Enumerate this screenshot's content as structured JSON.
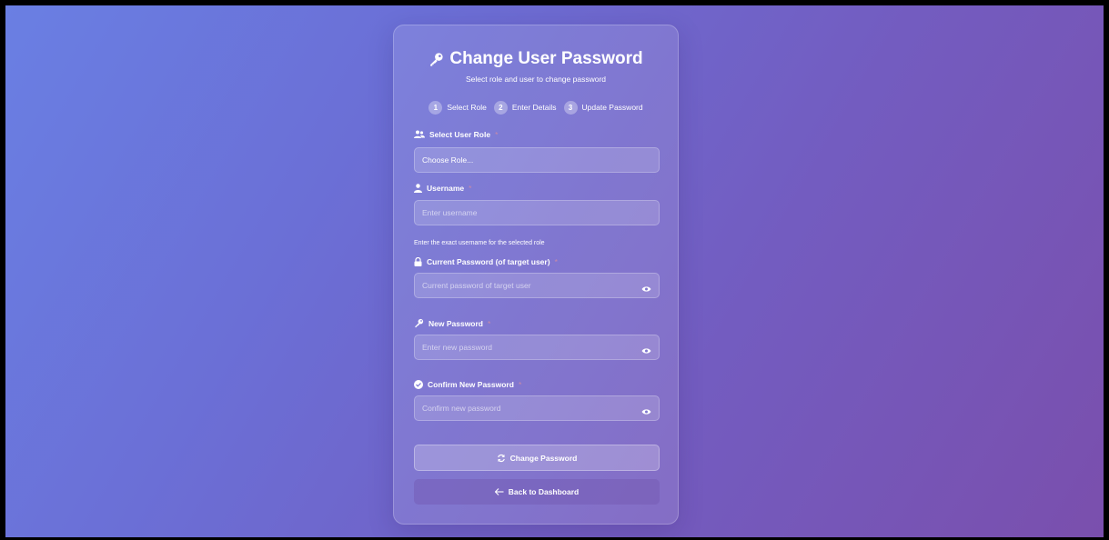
{
  "card": {
    "title": "Change User Password",
    "subtitle": "Select role and user to change password",
    "title_icon": "key-icon"
  },
  "steps": [
    {
      "num": "1",
      "label": "Select Role"
    },
    {
      "num": "2",
      "label": "Enter Details"
    },
    {
      "num": "3",
      "label": "Update Password"
    }
  ],
  "form": {
    "role": {
      "label": "Select User Role",
      "required": "*",
      "value": "Choose Role...",
      "icon": "users-icon"
    },
    "username": {
      "label": "Username",
      "required": "*",
      "placeholder": "Enter username",
      "hint": "Enter the exact username for the selected role",
      "icon": "user-icon"
    },
    "current_password": {
      "label": "Current Password (of target user)",
      "required": "*",
      "placeholder": "Current password of target user",
      "icon": "lock-icon"
    },
    "new_password": {
      "label": "New Password",
      "required": "*",
      "placeholder": "Enter new password",
      "icon": "key-icon"
    },
    "confirm_password": {
      "label": "Confirm New Password",
      "required": "*",
      "placeholder": "Confirm new password",
      "icon": "check-circle-icon"
    }
  },
  "buttons": {
    "change_password": "Change Password",
    "back": "Back to Dashboard"
  },
  "colors": {
    "gradient_start": "#6a7fe3",
    "gradient_end": "#7a4fad",
    "required": "#c98aa8"
  }
}
